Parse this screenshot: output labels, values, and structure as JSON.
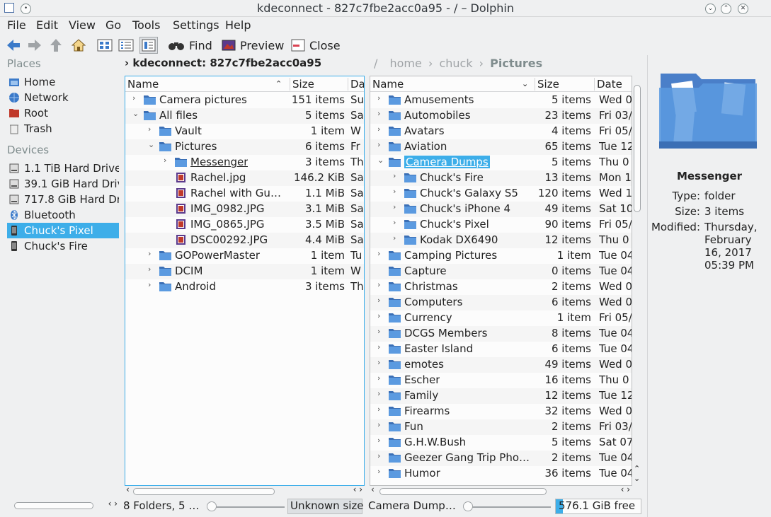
{
  "window": {
    "title": "kdeconnect - 827c7fbe2acc0a95 - / – Dolphin"
  },
  "menu": [
    "File",
    "Edit",
    "View",
    "Go",
    "Tools",
    "Settings",
    "Help"
  ],
  "toolbar": {
    "find": "Find",
    "preview": "Preview",
    "close": "Close"
  },
  "places": {
    "places_header": "Places",
    "items": [
      {
        "label": "Home",
        "icon": "home-icon"
      },
      {
        "label": "Network",
        "icon": "network-icon"
      },
      {
        "label": "Root",
        "icon": "root-folder-icon"
      },
      {
        "label": "Trash",
        "icon": "trash-icon"
      }
    ],
    "devices_header": "Devices",
    "devices": [
      {
        "label": "1.1 TiB Hard Drive"
      },
      {
        "label": "39.1 GiB Hard Drive"
      },
      {
        "label": "717.8 GiB Hard Drive"
      },
      {
        "label": "Bluetooth"
      },
      {
        "label": "Chuck's Pixel"
      },
      {
        "label": "Chuck's Fire"
      }
    ]
  },
  "left_pane": {
    "location": "kdeconnect: 827c7fbe2acc0a95",
    "columns": {
      "name": "Name",
      "size": "Size",
      "date": "Da"
    },
    "rows": [
      {
        "name": "Camera pictures",
        "size": "151 items",
        "date": "Su",
        "level": 0,
        "expander": "›",
        "type": "folder"
      },
      {
        "name": "All files",
        "size": "5 items",
        "date": "Sa",
        "level": 0,
        "expander": "⌄",
        "type": "folder"
      },
      {
        "name": "Vault",
        "size": "1 item",
        "date": "W",
        "level": 1,
        "expander": "›",
        "type": "folder"
      },
      {
        "name": "Pictures",
        "size": "6 items",
        "date": "Fr",
        "level": 1,
        "expander": "⌄",
        "type": "folder"
      },
      {
        "name": "Messenger",
        "size": "3 items",
        "date": "Th",
        "level": 2,
        "expander": "›",
        "type": "folder"
      },
      {
        "name": "Rachel.jpg",
        "size": "146.2 KiB",
        "date": "Sa",
        "level": 2,
        "expander": "",
        "type": "image"
      },
      {
        "name": "Rachel with Gun…",
        "size": "1.1 MiB",
        "date": "Sa",
        "level": 2,
        "expander": "",
        "type": "image"
      },
      {
        "name": "IMG_0982.JPG",
        "size": "3.1 MiB",
        "date": "Sa",
        "level": 2,
        "expander": "",
        "type": "image"
      },
      {
        "name": "IMG_0865.JPG",
        "size": "3.5 MiB",
        "date": "Sa",
        "level": 2,
        "expander": "",
        "type": "image"
      },
      {
        "name": "DSC00292.JPG",
        "size": "4.4 MiB",
        "date": "Sa",
        "level": 2,
        "expander": "",
        "type": "image"
      },
      {
        "name": "GOPowerMaster",
        "size": "1 item",
        "date": "Tu",
        "level": 1,
        "expander": "›",
        "type": "folder"
      },
      {
        "name": "DCIM",
        "size": "1 item",
        "date": "W",
        "level": 1,
        "expander": "›",
        "type": "folder"
      },
      {
        "name": "Android",
        "size": "3 items",
        "date": "Th",
        "level": 1,
        "expander": "›",
        "type": "folder"
      }
    ]
  },
  "right_pane": {
    "breadcrumb": [
      "/",
      "home",
      "chuck",
      "Pictures"
    ],
    "columns": {
      "name": "Name",
      "size": "Size",
      "date": "Date"
    },
    "rows": [
      {
        "name": "Amusements",
        "size": "5 items",
        "date": "Wed 0",
        "level": 0,
        "expander": "›"
      },
      {
        "name": "Automobiles",
        "size": "23 items",
        "date": "Fri 03/",
        "level": 0,
        "expander": "›"
      },
      {
        "name": "Avatars",
        "size": "4 items",
        "date": "Fri 05/",
        "level": 0,
        "expander": "›"
      },
      {
        "name": "Aviation",
        "size": "65 items",
        "date": "Tue 12",
        "level": 0,
        "expander": "›"
      },
      {
        "name": "Camera Dumps",
        "size": "5 items",
        "date": "Thu 0",
        "level": 0,
        "expander": "⌄",
        "selected": true
      },
      {
        "name": "Chuck's Fire",
        "size": "13 items",
        "date": "Mon 1",
        "level": 1,
        "expander": "›"
      },
      {
        "name": "Chuck's Galaxy S5",
        "size": "120 items",
        "date": "Wed 1",
        "level": 1,
        "expander": "›"
      },
      {
        "name": "Chuck's iPhone 4",
        "size": "49 items",
        "date": "Sat 10",
        "level": 1,
        "expander": "›"
      },
      {
        "name": "Chuck's Pixel",
        "size": "90 items",
        "date": "Fri 05/",
        "level": 1,
        "expander": "›"
      },
      {
        "name": "Kodak DX6490",
        "size": "12 items",
        "date": "Thu 0",
        "level": 1,
        "expander": "›"
      },
      {
        "name": "Camping Pictures",
        "size": "1 item",
        "date": "Tue 04",
        "level": 0,
        "expander": "›"
      },
      {
        "name": "Capture",
        "size": "0 items",
        "date": "Tue 04",
        "level": 0,
        "expander": ""
      },
      {
        "name": "Christmas",
        "size": "2 items",
        "date": "Wed 0",
        "level": 0,
        "expander": "›"
      },
      {
        "name": "Computers",
        "size": "6 items",
        "date": "Wed 0",
        "level": 0,
        "expander": "›"
      },
      {
        "name": "Currency",
        "size": "1 item",
        "date": "Fri 05/",
        "level": 0,
        "expander": "›"
      },
      {
        "name": "DCGS Members",
        "size": "8 items",
        "date": "Tue 04",
        "level": 0,
        "expander": "›"
      },
      {
        "name": "Easter Island",
        "size": "6 items",
        "date": "Tue 04",
        "level": 0,
        "expander": "›"
      },
      {
        "name": "emotes",
        "size": "49 items",
        "date": "Wed 0",
        "level": 0,
        "expander": "›"
      },
      {
        "name": "Escher",
        "size": "16 items",
        "date": "Thu 0",
        "level": 0,
        "expander": "›"
      },
      {
        "name": "Family",
        "size": "12 items",
        "date": "Tue 12",
        "level": 0,
        "expander": "›"
      },
      {
        "name": "Firearms",
        "size": "32 items",
        "date": "Wed 0",
        "level": 0,
        "expander": "›"
      },
      {
        "name": "Fun",
        "size": "2 items",
        "date": "Fri 03/",
        "level": 0,
        "expander": "›"
      },
      {
        "name": "G.H.W.Bush",
        "size": "5 items",
        "date": "Sat 07",
        "level": 0,
        "expander": "›"
      },
      {
        "name": "Geezer Gang Trip Photos",
        "size": "2 items",
        "date": "Tue 04",
        "level": 0,
        "expander": "›"
      },
      {
        "name": "Humor",
        "size": "36 items",
        "date": "Tue 04",
        "level": 0,
        "expander": "›"
      }
    ]
  },
  "status": {
    "left_text": "8 Folders, 5 …",
    "left_space": "Unknown size",
    "right_text": "Camera Dump…",
    "right_space": "576.1 GiB free",
    "right_space_fraction": 0.08
  },
  "info": {
    "name": "Messenger",
    "type_label": "Type:",
    "type_value": "folder",
    "size_label": "Size:",
    "size_value": "3 items",
    "modified_label": "Modified:",
    "modified_lines": [
      "Thursday,",
      "February",
      "16, 2017",
      "05:39 PM"
    ]
  },
  "colors": {
    "accent": "#3daee9",
    "folder": "#5b8fd4",
    "background": "#eff0f1"
  }
}
